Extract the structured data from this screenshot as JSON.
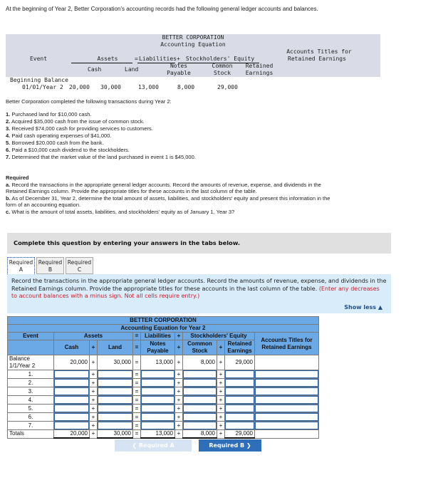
{
  "intro": "At the beginning of Year 2, Better Corporation's accounting records had the following general ledger accounts and balances.",
  "problem_table": {
    "title1": "BETTER CORPORATION",
    "title2": "Accounting Equation",
    "event": "Event",
    "assets": "Assets",
    "eq": "=",
    "liabilities": "Liabilities",
    "plus": "+",
    "se": "Stockholders' Equity",
    "acct_titles": "Accounts Titles for",
    "acct_titles2": "Retained Earnings",
    "cash": "Cash",
    "land": "Land",
    "notes1": "Notes",
    "notes2": "Payable",
    "common1": "Common",
    "common2": "Stock",
    "retained1": "Retained",
    "retained2": "Earnings",
    "beg1": "Beginning Balance",
    "beg2": "01/01/Year 2",
    "values": {
      "cash": "20,000",
      "land": "30,000",
      "notes": "13,000",
      "common": "8,000",
      "retained": "29,000"
    }
  },
  "transactions_intro": "Better Corporation completed the following transactions during Year 2:",
  "transactions": [
    {
      "n": "1.",
      "text": "Purchased land for $10,000 cash."
    },
    {
      "n": "2.",
      "text": "Acquired $35,000 cash from the issue of common stock."
    },
    {
      "n": "3.",
      "text": "Received $74,000 cash for providing services to customers."
    },
    {
      "n": "4.",
      "text": "Paid cash operating expenses of $41,000."
    },
    {
      "n": "5.",
      "text": "Borrowed $20,000 cash from the bank."
    },
    {
      "n": "6.",
      "text": "Paid a $10,000 cash dividend to the stockholders."
    },
    {
      "n": "7.",
      "text": "Determined that the market value of the land purchased in event 1 is $45,000."
    }
  ],
  "required": {
    "heading": "Required",
    "a_label": "a.",
    "a": "Record the transactions in the appropriate general ledger accounts. Record the amounts of revenue, expense, and dividends in the Retained Earnings column. Provide the appropriate titles for these accounts in the last column of the table.",
    "b_label": "b.",
    "b": "As of December 31, Year 2, determine the total amount of assets, liabilities, and stockholders' equity and present this information in the form of an accounting equation.",
    "c_label": "c.",
    "c": "What is the amount of total assets, liabilities, and stockholders' equity as of January 1, Year 3?"
  },
  "complete_banner": "Complete this question by entering your answers in the tabs below.",
  "tabs": [
    {
      "line1": "Required",
      "line2": "A",
      "active": true
    },
    {
      "line1": "Required",
      "line2": "B",
      "active": false
    },
    {
      "line1": "Required",
      "line2": "C",
      "active": false
    }
  ],
  "panel": {
    "instructions": "Record the transactions in the appropriate general ledger accounts. Record the amounts of revenue, expense, and dividends in the Retained Earnings column. Provide the appropriate titles for these accounts in the last column of the table.",
    "note": "(Enter any decreases to account balances with a minus sign. Not all cells require entry.)",
    "show_less": "Show less ▲"
  },
  "answer_table": {
    "title1": "BETTER CORPORATION",
    "title2": "Accounting Equation for Year 2",
    "event": "Event",
    "assets": "Assets",
    "eq": "=",
    "plus": "+",
    "liabilities": "Liabilities",
    "se": "Stockholders' Equity",
    "acct_titles": "Accounts Titles for Retained Earnings",
    "cash": "Cash",
    "land": "Land",
    "notes": "Notes Payable",
    "common": "Common Stock",
    "retained": "Retained Earnings",
    "balance_label": "Balance 1/1/Year 2",
    "balance": {
      "cash": "20,000",
      "land": "30,000",
      "notes": "13,000",
      "common": "8,000",
      "retained": "29,000"
    },
    "rows": [
      "1.",
      "2.",
      "3.",
      "4.",
      "5.",
      "6.",
      "7."
    ],
    "totals_label": "Totals",
    "totals": {
      "cash": "20,000",
      "land": "30,000",
      "notes": "13,000",
      "common": "8,000",
      "retained": "29,000"
    }
  },
  "nav": {
    "prev": "❮  Required A",
    "next": "Required B  ❯"
  }
}
